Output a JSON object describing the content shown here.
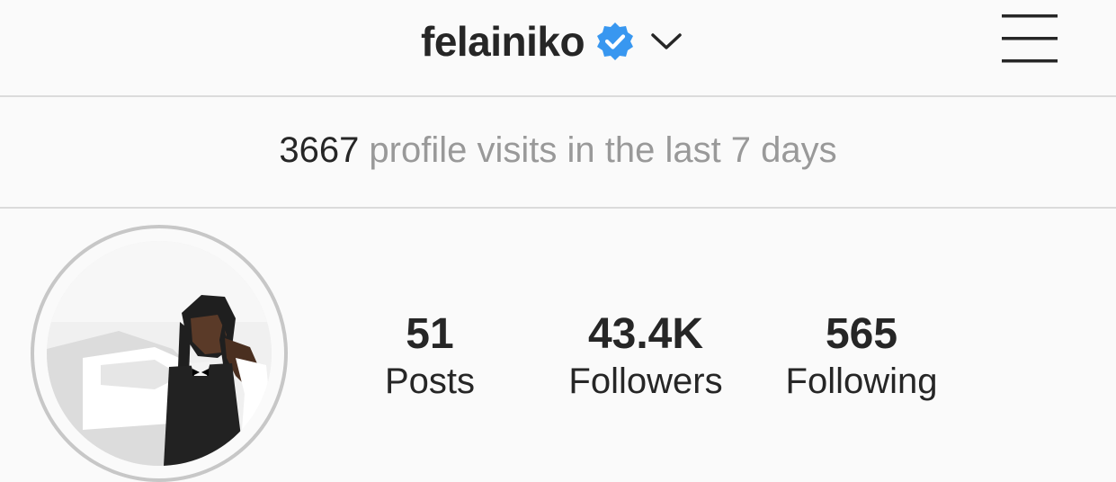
{
  "header": {
    "username": "felainiko",
    "verified_icon": "verified-badge-icon",
    "dropdown_icon": "chevron-down-icon",
    "menu_icon": "hamburger-menu-icon"
  },
  "visits": {
    "count": "3667",
    "text": " profile visits in the last 7 days"
  },
  "profile": {
    "avatar_icon": "profile-avatar"
  },
  "stats": [
    {
      "value": "51",
      "label": "Posts"
    },
    {
      "value": "43.4K",
      "label": "Followers"
    },
    {
      "value": "565",
      "label": "Following"
    }
  ],
  "colors": {
    "background": "#fafafa",
    "text": "#262626",
    "muted_text": "#999999",
    "divider": "#dbdbdb",
    "verified_blue": "#3897f0"
  }
}
